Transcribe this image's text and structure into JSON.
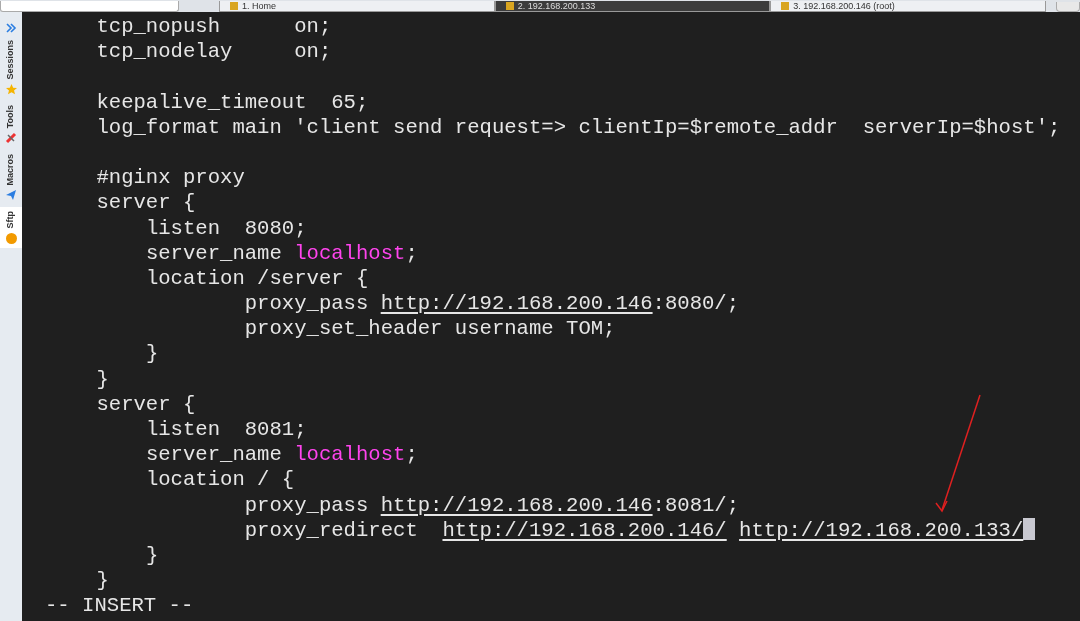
{
  "tabs": [
    {
      "label": "1. Home",
      "selected": false
    },
    {
      "label": "2. 192.168.200.133",
      "selected": true
    },
    {
      "label": "3. 192.168.200.146 (root)",
      "selected": false
    }
  ],
  "sidebar": {
    "items": [
      {
        "label": "Sessions",
        "kind": "star",
        "selected": false
      },
      {
        "label": "Tools",
        "kind": "tools",
        "selected": false
      },
      {
        "label": "Macros",
        "kind": "plane",
        "selected": false
      },
      {
        "label": "Sftp",
        "kind": "dot",
        "selected": true
      }
    ]
  },
  "terminal": {
    "lines": [
      {
        "segments": [
          {
            "kind": "text",
            "text": "    tcp_nopush      on;"
          }
        ]
      },
      {
        "segments": [
          {
            "kind": "text",
            "text": "    tcp_nodelay     on;"
          }
        ]
      },
      {
        "gap_before": true,
        "segments": [
          {
            "kind": "text",
            "text": "    keepalive_timeout  65;"
          }
        ]
      },
      {
        "segments": [
          {
            "kind": "text",
            "text": "    log_format main 'client send request=> clientIp=$remote_addr  serverIp=$host';"
          }
        ]
      },
      {
        "gap_before": true,
        "segments": [
          {
            "kind": "text",
            "text": "    #nginx proxy"
          }
        ]
      },
      {
        "segments": [
          {
            "kind": "text",
            "text": "    server {"
          }
        ]
      },
      {
        "segments": [
          {
            "kind": "text",
            "text": "        listen  8080;"
          }
        ]
      },
      {
        "segments": [
          {
            "kind": "text",
            "text": "        server_name "
          },
          {
            "kind": "keyword",
            "text": "localhost"
          },
          {
            "kind": "text",
            "text": ";"
          }
        ]
      },
      {
        "segments": [
          {
            "kind": "text",
            "text": "        location /server {"
          }
        ]
      },
      {
        "segments": [
          {
            "kind": "text",
            "text": "                proxy_pass "
          },
          {
            "kind": "link",
            "text": "http://192.168.200.146"
          },
          {
            "kind": "text",
            "text": ":8080/;"
          }
        ]
      },
      {
        "segments": [
          {
            "kind": "text",
            "text": "                proxy_set_header username TOM;"
          }
        ]
      },
      {
        "segments": [
          {
            "kind": "text",
            "text": "        }"
          }
        ]
      },
      {
        "segments": [
          {
            "kind": "text",
            "text": "    }"
          }
        ]
      },
      {
        "segments": [
          {
            "kind": "text",
            "text": "    server {"
          }
        ]
      },
      {
        "segments": [
          {
            "kind": "text",
            "text": "        listen  8081;"
          }
        ]
      },
      {
        "segments": [
          {
            "kind": "text",
            "text": "        server_name "
          },
          {
            "kind": "keyword",
            "text": "localhost"
          },
          {
            "kind": "text",
            "text": ";"
          }
        ]
      },
      {
        "segments": [
          {
            "kind": "text",
            "text": "        location / {"
          }
        ]
      },
      {
        "segments": [
          {
            "kind": "text",
            "text": "                proxy_pass "
          },
          {
            "kind": "link",
            "text": "http://192.168.200.146"
          },
          {
            "kind": "text",
            "text": ":8081/;"
          }
        ]
      },
      {
        "segments": [
          {
            "kind": "text",
            "text": "                proxy_redirect  "
          },
          {
            "kind": "link",
            "text": "http://192.168.200.146/"
          },
          {
            "kind": "link",
            "text": " http://192.168.200.133/"
          }
        ],
        "cursor": true
      },
      {
        "segments": [
          {
            "kind": "text",
            "text": "        }"
          }
        ]
      },
      {
        "segments": [
          {
            "kind": "text",
            "text": "    }"
          }
        ]
      }
    ],
    "mode": "-- INSERT --"
  }
}
